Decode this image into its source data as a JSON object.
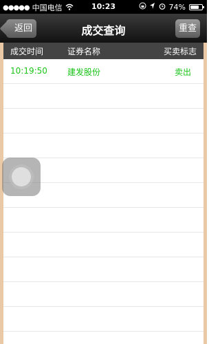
{
  "status_bar": {
    "carrier": "中国电信",
    "time": "10:23",
    "battery_text": "74%",
    "battery_level": 0.74
  },
  "nav": {
    "title": "成交查询",
    "back_label": "返回",
    "reset_label": "重查"
  },
  "table": {
    "headers": [
      "成交时间",
      "证券名称",
      "买卖标志"
    ],
    "rows": [
      {
        "time": "10:19:50",
        "name": "建发股份",
        "side": "卖出"
      }
    ]
  },
  "colors": {
    "accent": "#19c419",
    "header_bg": "#444444",
    "frame": "#e9c9a6"
  }
}
